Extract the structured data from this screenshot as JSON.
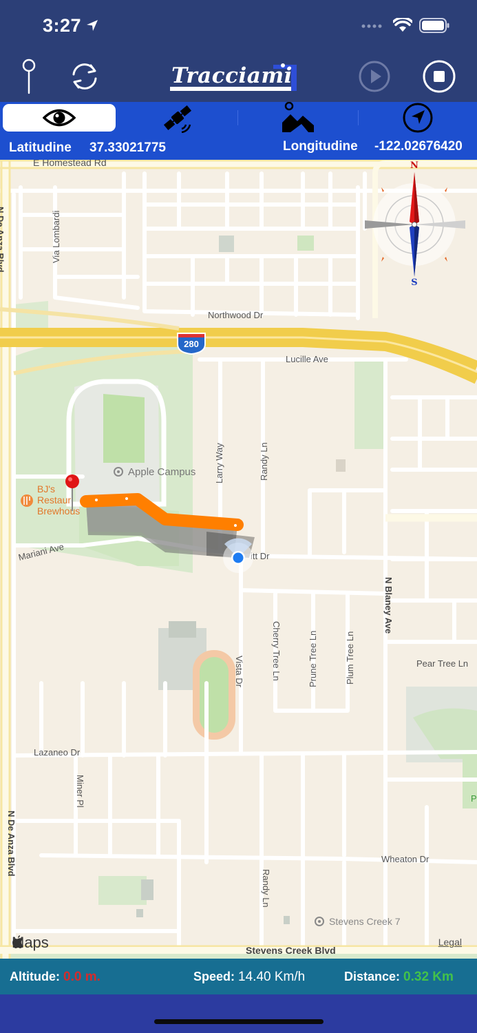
{
  "status_bar": {
    "time": "3:27"
  },
  "header": {
    "logo_text": "Tracciami"
  },
  "tabs": [
    {
      "name": "tab-view",
      "icon": "eye-icon",
      "active": true
    },
    {
      "name": "tab-satellite",
      "icon": "satellite-icon",
      "active": false
    },
    {
      "name": "tab-terrain",
      "icon": "mountain-icon",
      "active": false
    },
    {
      "name": "tab-navigation",
      "icon": "location-arrow-icon",
      "active": false
    }
  ],
  "coordinates": {
    "latitude_label": "Latitudine",
    "latitude_value": "37.33021775",
    "longitude_label": "Longitudine",
    "longitude_value": "-122.02676420"
  },
  "map": {
    "streets": {
      "homestead": "E Homestead Rd",
      "lombardi": "Via Lombardi",
      "northwood": "Northwood Dr",
      "lucille": "Lucille Ave",
      "larry": "Larry Way",
      "randy_north": "Randy Ln",
      "mariani": "Mariani Ave",
      "pruneridge": "itt Dr",
      "blaney": "N Blaney Ave",
      "cherry": "Cherry Tree Ln",
      "prune": "Prune Tree Ln",
      "plum": "Plum Tree Ln",
      "pear": "Pear Tree Ln",
      "vista": "Vista Dr",
      "lazaneo": "Lazaneo Dr",
      "miner": "Miner Pl",
      "deanza": "N De Anza Blvd",
      "wheaton": "Wheaton Dr",
      "randy_south": "Randy Ln",
      "stevens_creek": "Stevens Creek Blvd",
      "deanza_left": "N De Anza Blvd"
    },
    "highway_shield": "280",
    "pois": {
      "apple_campus": "Apple Campus",
      "bjs_line1": "BJ's",
      "bjs_line2": "Restaur",
      "bjs_line3": "Brewhous",
      "stevens_creek_7": "Stevens Creek 7",
      "partial_poi": "P"
    },
    "compass": {
      "north": "N",
      "south": "S"
    },
    "attribution": "Maps",
    "legal": "Legal"
  },
  "stats": {
    "altitude_label": "Altitude:",
    "altitude_value": "0.0 m.",
    "speed_label": "Speed:",
    "speed_value": "14.40 Km/h",
    "distance_label": "Distance:",
    "distance_value": "0.32 Km"
  },
  "colors": {
    "header_bg": "#2c3f77",
    "tab_bar_bg": "#1d4fcf",
    "bottom_bar_bg": "#176e92",
    "track": "#ff7f00",
    "altitude_value": "#d62b2b",
    "speed_value": "#ffffff",
    "distance_value": "#43c24a"
  }
}
